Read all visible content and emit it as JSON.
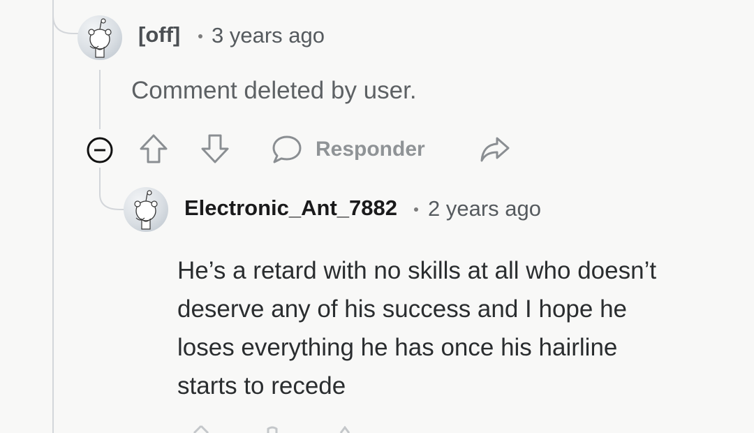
{
  "comments": [
    {
      "author": "[off]",
      "timestamp": "3 years ago",
      "body": "Comment deleted by user.",
      "actions": {
        "reply_label": "Responder"
      }
    },
    {
      "author": "Electronic_Ant_7882",
      "timestamp": "2 years ago",
      "body_lines": [
        "He’s a retard with no skills at all who doesn’t",
        "deserve any of his success and I hope he",
        "loses everything he has once his hairline",
        "starts to recede"
      ]
    }
  ],
  "icons": {
    "collapse": "minus-circle-icon",
    "upvote": "arrow-up-icon",
    "downvote": "arrow-down-icon",
    "reply": "speech-bubble-icon",
    "share": "share-arrow-icon",
    "avatar": "snoo-avatar-icon"
  }
}
